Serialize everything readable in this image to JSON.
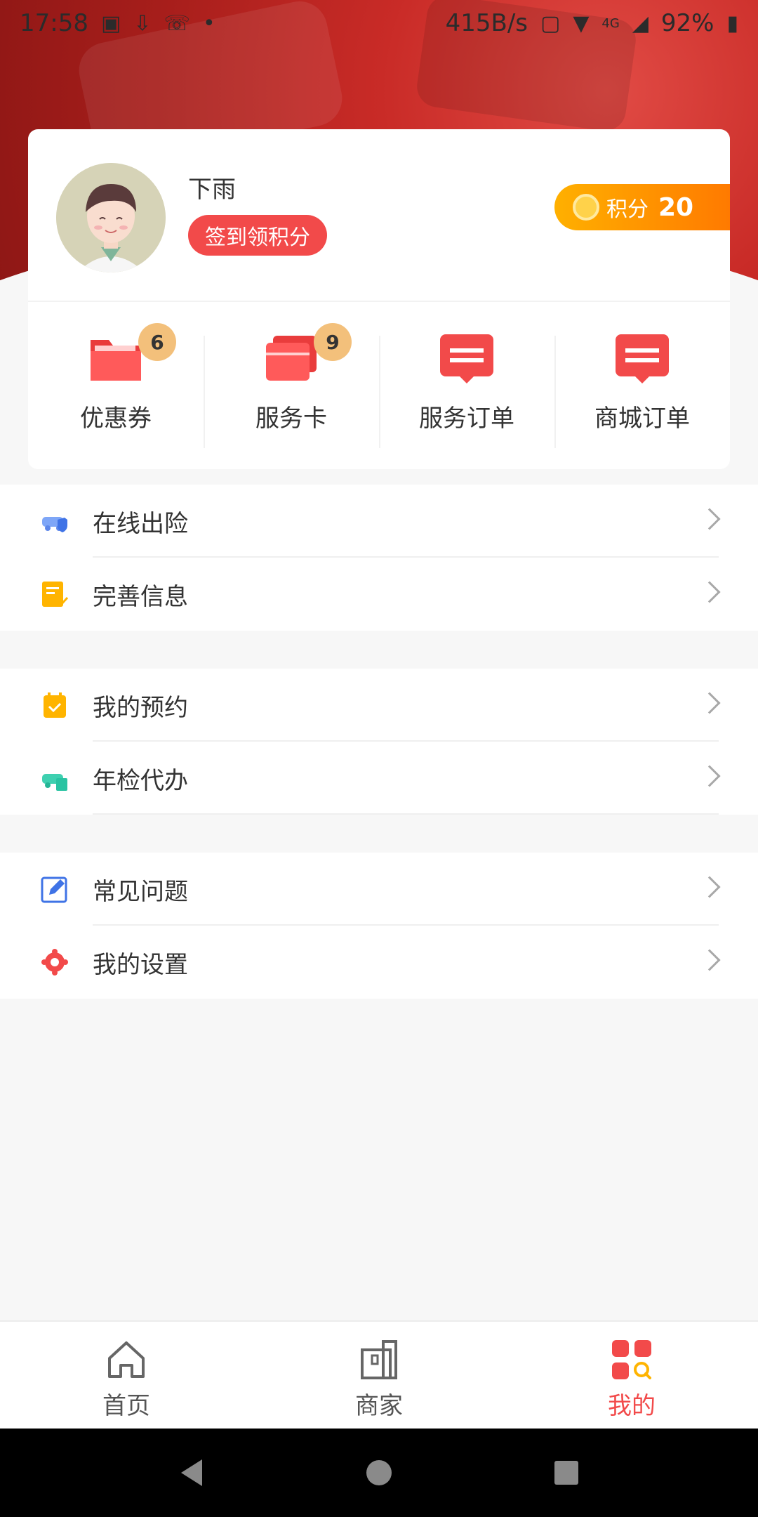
{
  "status_bar": {
    "time": "17:58",
    "speed": "415B/s",
    "battery": "92%",
    "network": "4G"
  },
  "profile": {
    "name": "下雨",
    "signin_label": "签到领积分",
    "points_label": "积分",
    "points_value": "20"
  },
  "quick_actions": [
    {
      "label": "优惠券",
      "badge": "6",
      "icon": "folder-icon"
    },
    {
      "label": "服务卡",
      "badge": "9",
      "icon": "cards-icon"
    },
    {
      "label": "服务订单",
      "icon": "order-icon"
    },
    {
      "label": "商城订单",
      "icon": "order-icon"
    }
  ],
  "menu_groups": [
    [
      {
        "label": "在线出险",
        "icon": "car-shield-icon"
      },
      {
        "label": "完善信息",
        "icon": "document-check-icon"
      }
    ],
    [
      {
        "label": "我的预约",
        "icon": "calendar-check-icon"
      },
      {
        "label": "年检代办",
        "icon": "car-doc-icon"
      }
    ],
    [
      {
        "label": "常见问题",
        "icon": "edit-icon"
      },
      {
        "label": "我的设置",
        "icon": "settings-icon"
      }
    ]
  ],
  "bottom_nav": [
    {
      "label": "首页",
      "icon": "home-icon"
    },
    {
      "label": "商家",
      "icon": "store-icon"
    },
    {
      "label": "我的",
      "icon": "mine-icon",
      "active": true
    }
  ],
  "colors": {
    "brand_red": "#f24a4a",
    "points_orange": "#ff8c00",
    "badge": "#f3c07b"
  }
}
